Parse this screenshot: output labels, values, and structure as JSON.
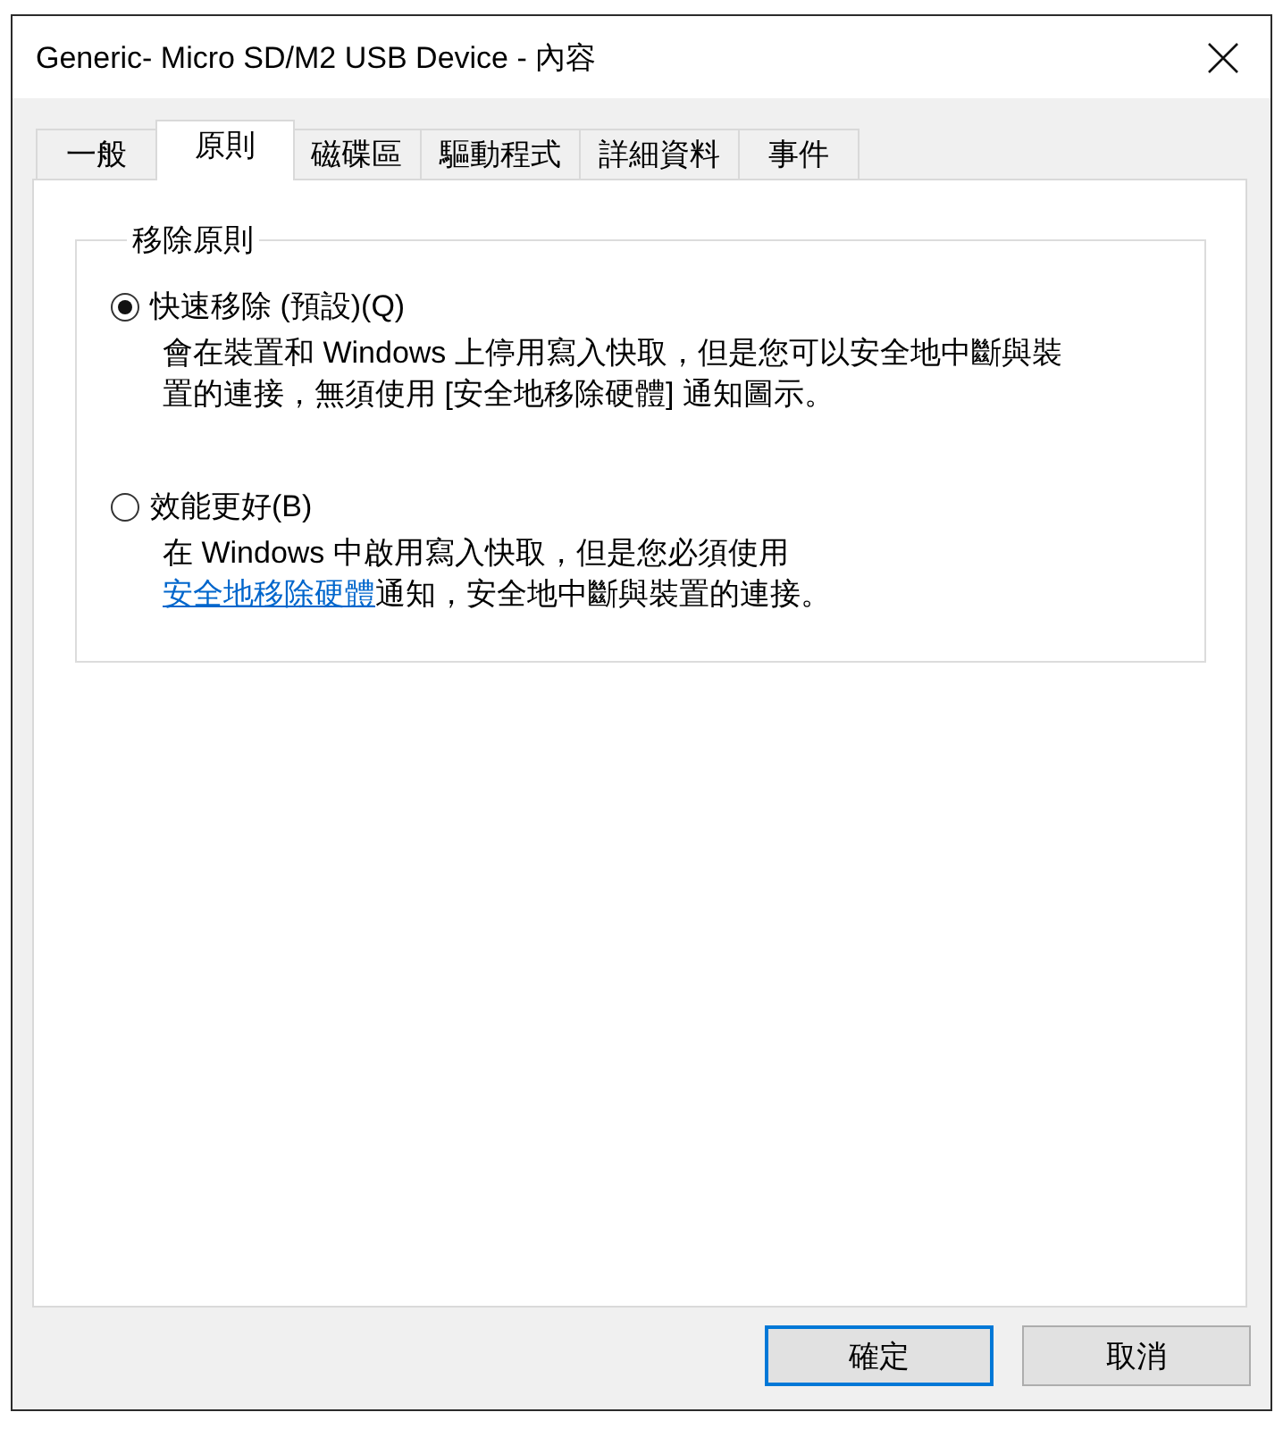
{
  "window": {
    "title": "Generic- Micro SD/M2 USB Device - 內容"
  },
  "tabs": [
    {
      "label": "一般",
      "selected": false
    },
    {
      "label": "原則",
      "selected": true
    },
    {
      "label": "磁碟區",
      "selected": false
    },
    {
      "label": "驅動程式",
      "selected": false
    },
    {
      "label": "詳細資料",
      "selected": false
    },
    {
      "label": "事件",
      "selected": false
    }
  ],
  "group": {
    "title": "移除原則",
    "options": [
      {
        "label": "快速移除 (預設)(Q)",
        "selected": true,
        "description": "會在裝置和 Windows 上停用寫入快取，但是您可以安全地中斷與裝置的連接，無須使用 [安全地移除硬體] 通知圖示。"
      },
      {
        "label": "效能更好(B)",
        "selected": false,
        "description": "在 Windows 中啟用寫入快取，但是您必須使用",
        "link": "安全地移除硬體",
        "description_after": "通知，安全地中斷與裝置的連接。"
      }
    ]
  },
  "buttons": [
    {
      "label": "確定",
      "default": true
    },
    {
      "label": "取消",
      "default": false
    }
  ]
}
